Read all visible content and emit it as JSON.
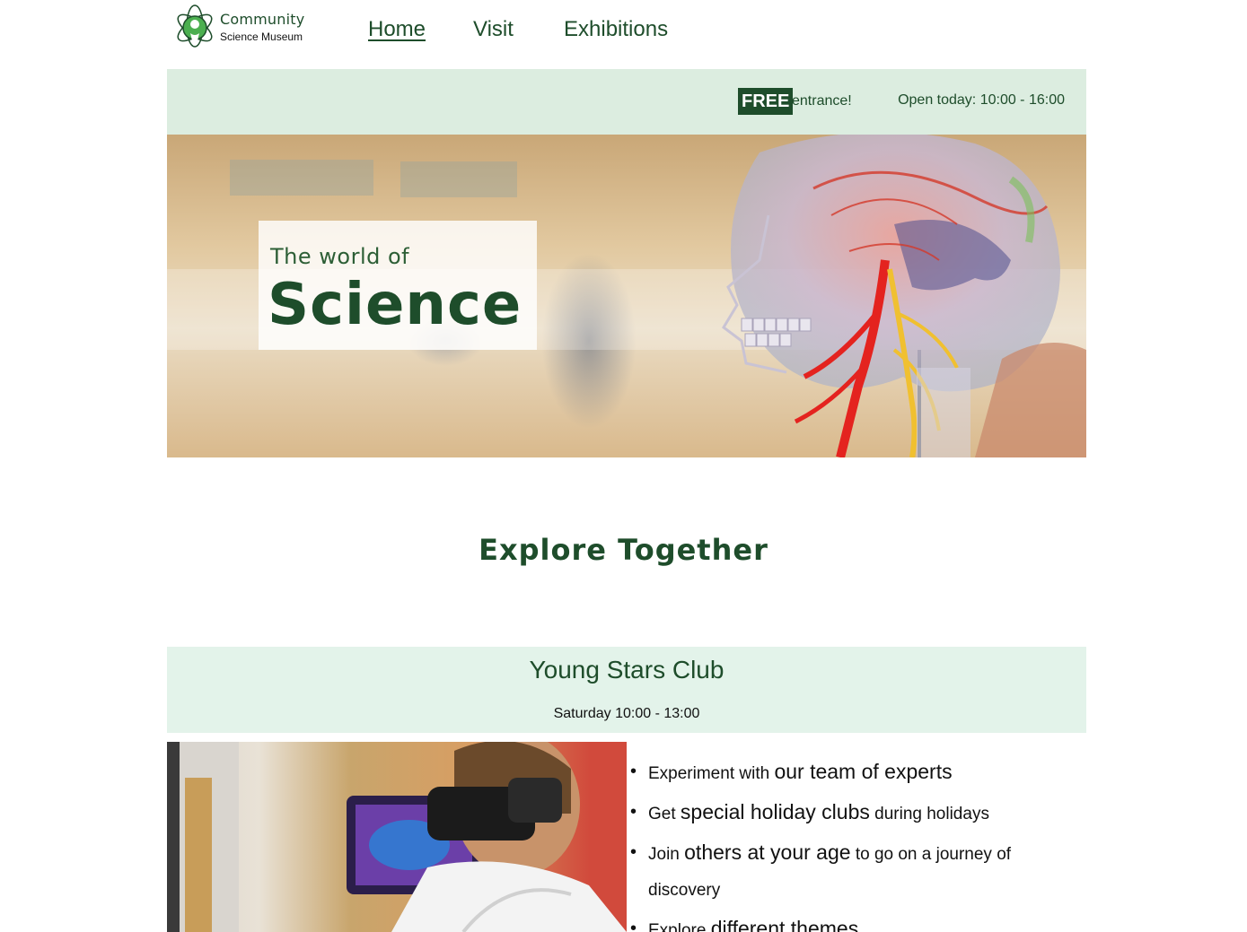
{
  "brand": {
    "title": "Community",
    "subtitle": "Science Museum"
  },
  "nav": {
    "items": [
      {
        "label": "Home",
        "active": true
      },
      {
        "label": "Visit",
        "active": false
      },
      {
        "label": "Exhibitions",
        "active": false
      }
    ]
  },
  "info_bar": {
    "free_badge": "FREE",
    "entrance_text": "entrance!",
    "opening_hours": "Open today: 10:00 - 16:00"
  },
  "hero": {
    "small_heading": "The world of",
    "big_heading": "Science"
  },
  "explore": {
    "heading": "Explore Together"
  },
  "club": {
    "title": "Young Stars Club",
    "time": "Saturday 10:00 - 13:00",
    "bullets": [
      {
        "pre": "Experiment with ",
        "em": "our team of experts",
        "post": ""
      },
      {
        "pre": "Get ",
        "em": "special holiday clubs",
        "post": " during holidays"
      },
      {
        "pre": "Join ",
        "em": "others at your age",
        "post": " to go on a journey of discovery"
      },
      {
        "pre": "Explore ",
        "em": "different themes",
        "post": ""
      }
    ]
  },
  "colors": {
    "brand_green": "#1e4d2b",
    "info_bar_bg": "#dcede0",
    "club_header_bg": "#e3f3ea"
  }
}
